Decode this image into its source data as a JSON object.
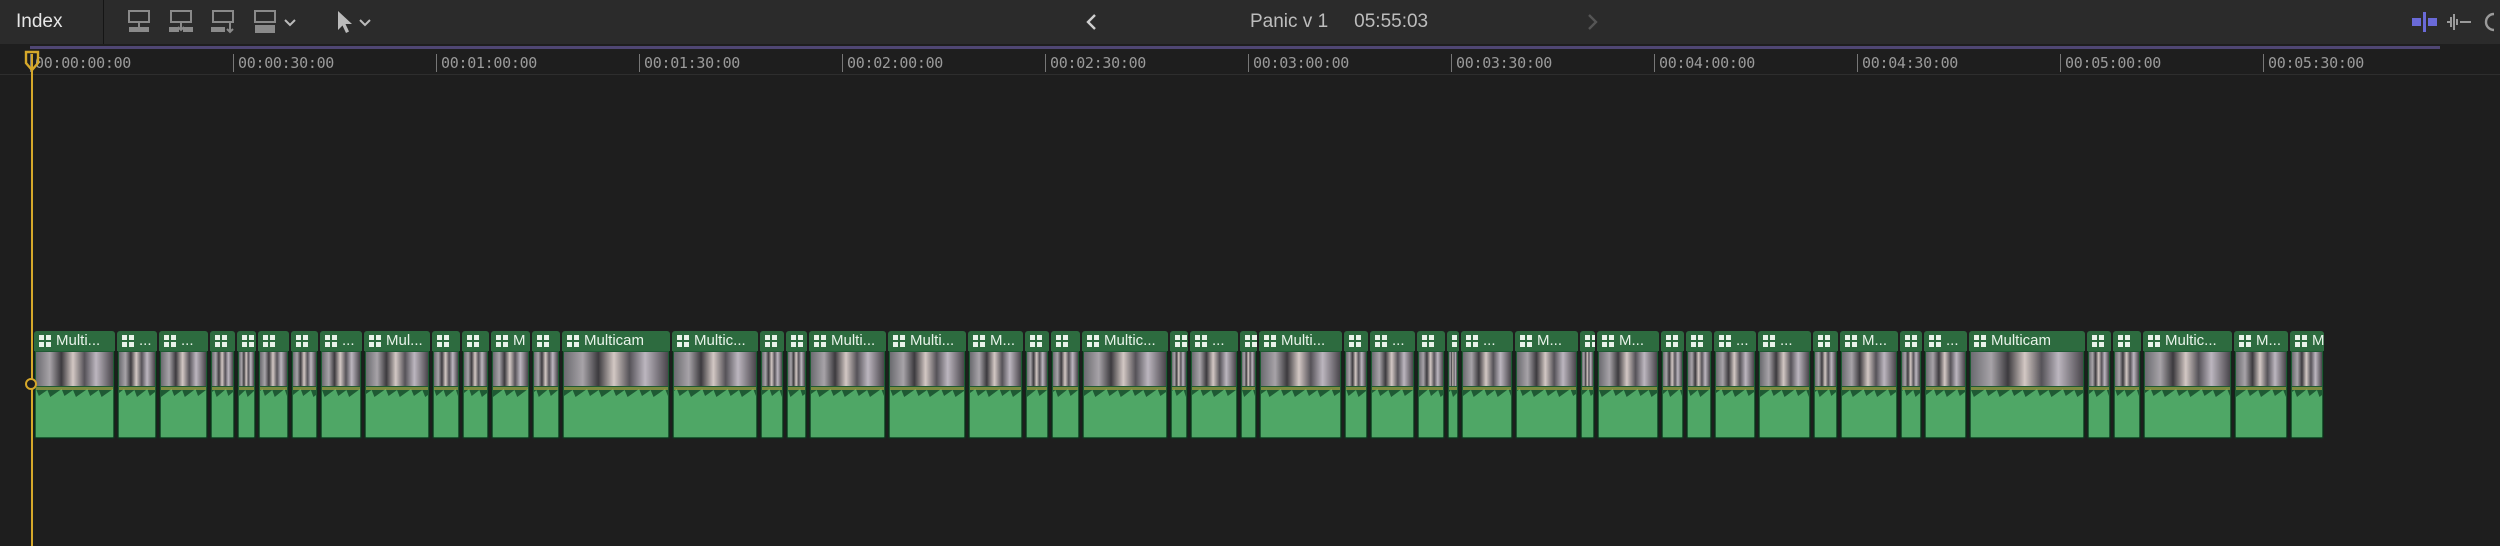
{
  "toolbar": {
    "index_label": "Index",
    "project_name": "Panic v 1",
    "duration": "05:55:03",
    "icons": [
      "connect-clip-icon",
      "insert-clip-icon",
      "append-clip-icon",
      "overwrite-clip-icon",
      "select-arrow-icon",
      "back-arrow-icon",
      "forward-arrow-icon",
      "clip-appearance-icon",
      "audio-skimming-icon",
      "snapping-icon"
    ]
  },
  "ruler": {
    "ticks": [
      "00:00:00:00",
      "00:00:30:00",
      "00:01:00:00",
      "00:01:30:00",
      "00:02:00:00",
      "00:02:30:00",
      "00:03:00:00",
      "00:03:30:00",
      "00:04:00:00",
      "00:04:30:00",
      "00:05:00:00",
      "00:05:30:00"
    ]
  },
  "colors": {
    "playhead": "#d6a82a",
    "clip_body": "#1f5a34",
    "clip_header": "#2d6b3f",
    "waveform": "#4fa766"
  },
  "clips": [
    {
      "title": "Multi..."
    },
    {
      "title": "..."
    },
    {
      "title": "..."
    },
    {
      "title": ""
    },
    {
      "title": ""
    },
    {
      "title": ""
    },
    {
      "title": ""
    },
    {
      "title": "..."
    },
    {
      "title": "Mul..."
    },
    {
      "title": ""
    },
    {
      "title": ""
    },
    {
      "title": "M"
    },
    {
      "title": ""
    },
    {
      "title": "Multicam"
    },
    {
      "title": "Multic..."
    },
    {
      "title": ""
    },
    {
      "title": ""
    },
    {
      "title": "Multi..."
    },
    {
      "title": "Multi..."
    },
    {
      "title": "M..."
    },
    {
      "title": ""
    },
    {
      "title": ""
    },
    {
      "title": "Multic..."
    },
    {
      "title": "M"
    },
    {
      "title": "..."
    },
    {
      "title": ""
    },
    {
      "title": "Multi..."
    },
    {
      "title": ""
    },
    {
      "title": "..."
    },
    {
      "title": ""
    },
    {
      "title": ""
    },
    {
      "title": "..."
    },
    {
      "title": "M..."
    },
    {
      "title": ""
    },
    {
      "title": "M..."
    },
    {
      "title": ""
    },
    {
      "title": ""
    },
    {
      "title": "..."
    },
    {
      "title": "..."
    },
    {
      "title": ""
    },
    {
      "title": "M..."
    },
    {
      "title": ""
    },
    {
      "title": "..."
    },
    {
      "title": "Multicam"
    },
    {
      "title": ""
    },
    {
      "title": ""
    },
    {
      "title": "Multic..."
    },
    {
      "title": "M..."
    },
    {
      "title": "M"
    }
  ]
}
